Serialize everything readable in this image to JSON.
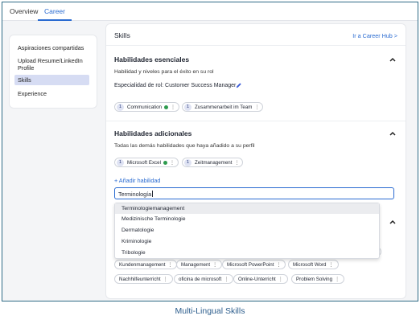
{
  "tabs": [
    {
      "label": "Overview"
    },
    {
      "label": "Career"
    }
  ],
  "sidebar": {
    "items": [
      {
        "label": "Aspiraciones compartidas"
      },
      {
        "label": "Upload Resume/LinkedIn Profile"
      },
      {
        "label": "Skills"
      },
      {
        "label": "Experience"
      }
    ]
  },
  "main": {
    "title": "Skills",
    "hub_link": "Ir a Career Hub >",
    "essential": {
      "title": "Habilidades esenciales",
      "subtitle": "Habilidad y niveles para el éxito en su rol",
      "role_label": "Especialidad de rol: Customer Success Manager",
      "chips": [
        {
          "level": "1",
          "label": "Communication"
        },
        {
          "level": "1",
          "label": "Zusammenarbeit im Team"
        }
      ]
    },
    "additional": {
      "title": "Habilidades adicionales",
      "subtitle": "Todas las demás habilidades que haya añadido a su perfil",
      "chips": [
        {
          "level": "1",
          "label": "Microsoft Excel"
        },
        {
          "level": "1",
          "label": "Zeitmanagement"
        }
      ],
      "add_link": "+ Añadir habilidad",
      "input_value": "Terminología",
      "suggestions": [
        "Terminologiemanagement",
        "Medizinische Terminologie",
        "Dermatologie",
        "Kriminologie",
        "Tribologie"
      ]
    },
    "suggested_chips": [
      [
        "Kundenmanagement",
        "Management",
        "Microsoft PowerPoint",
        "Microsoft Word"
      ],
      [
        "Nachhilfeunterricht",
        "oficina de microsoft",
        "Online-Unterricht",
        "Problem Solving"
      ]
    ]
  },
  "caption": "Multi-Lingual Skills",
  "colors": {
    "accent": "#2a6bd1",
    "selected_bg": "#d6dcf3",
    "frame": "#2f6b86",
    "caption": "#2d5e8d",
    "check": "#2e9b4f"
  }
}
